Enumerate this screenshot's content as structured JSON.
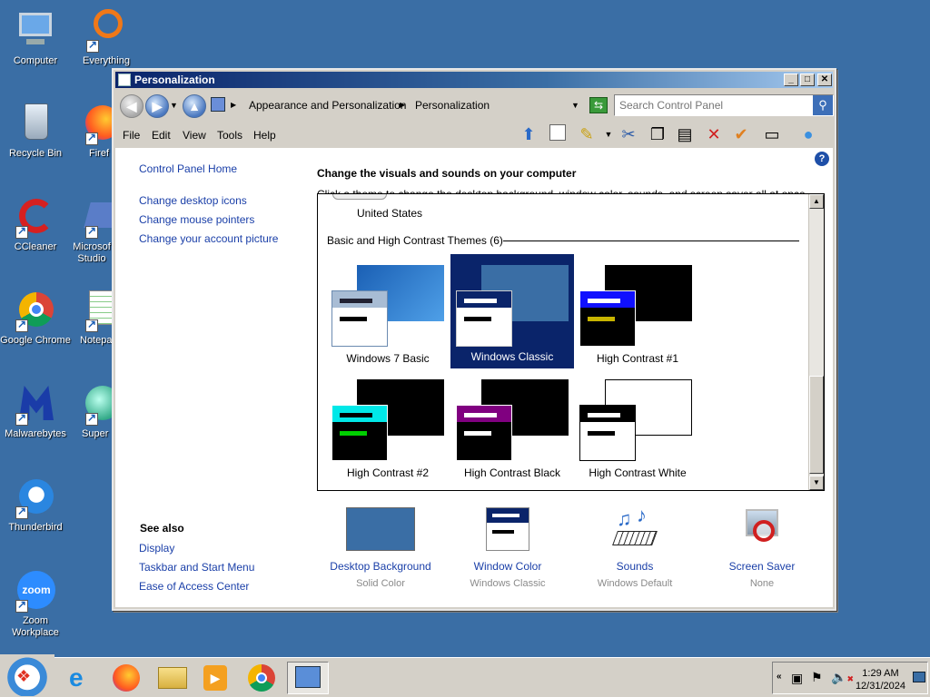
{
  "desktop": {
    "icons": [
      {
        "label": "Computer",
        "icon": "computer-icon"
      },
      {
        "label": "Everything",
        "icon": "everything-icon"
      },
      {
        "label": "Recycle Bin",
        "icon": "recycle-bin-icon"
      },
      {
        "label": "Firef",
        "icon": "firefox-icon"
      },
      {
        "label": "CCleaner",
        "icon": "ccleaner-icon"
      },
      {
        "label": "Microsof Studio",
        "icon": "microsoft-studio-icon"
      },
      {
        "label": "Google Chrome",
        "icon": "chrome-icon"
      },
      {
        "label": "Notepa",
        "icon": "notepad-icon"
      },
      {
        "label": "Malwarebytes",
        "icon": "malwarebytes-icon"
      },
      {
        "label": "Super",
        "icon": "super-icon"
      },
      {
        "label": "Thunderbird",
        "icon": "thunderbird-icon"
      },
      {
        "label": "Zoom Workplace",
        "icon": "zoom-icon"
      }
    ]
  },
  "window": {
    "title": "Personalization",
    "address": {
      "segment1": "Appearance and Personalization",
      "segment2": "Personalization"
    },
    "search": {
      "placeholder": "Search Control Panel"
    },
    "menu": {
      "file": "File",
      "edit": "Edit",
      "view": "View",
      "tools": "Tools",
      "help": "Help"
    }
  },
  "sidebar": {
    "home": "Control Panel Home",
    "links": [
      "Change desktop icons",
      "Change mouse pointers",
      "Change your account picture"
    ],
    "see_also_title": "See also",
    "see_also": [
      "Display",
      "Taskbar and Start Menu",
      "Ease of Access Center"
    ]
  },
  "main": {
    "heading": "Change the visuals and sounds on your computer",
    "subtext": "Click a theme to change the desktop background, window color, sounds, and screen saver all at once.",
    "partial_theme_label": "United States",
    "group_label": "Basic and High Contrast Themes (6)",
    "themes": [
      {
        "name": "Windows 7 Basic",
        "selected": false
      },
      {
        "name": "Windows Classic",
        "selected": true
      },
      {
        "name": "High Contrast #1",
        "selected": false
      },
      {
        "name": "High Contrast #2",
        "selected": false
      },
      {
        "name": "High Contrast Black",
        "selected": false
      },
      {
        "name": "High Contrast White",
        "selected": false
      }
    ]
  },
  "bottom": {
    "items": [
      {
        "label": "Desktop Background",
        "sub": "Solid Color"
      },
      {
        "label": "Window Color",
        "sub": "Windows Classic"
      },
      {
        "label": "Sounds",
        "sub": "Windows Default"
      },
      {
        "label": "Screen Saver",
        "sub": "None"
      }
    ]
  },
  "taskbar": {
    "time": "1:29 AM",
    "date": "12/31/2024"
  },
  "colors": {
    "desktop": "#3a6ea5",
    "selection": "#0a246a",
    "link": "#1a3fa8"
  }
}
